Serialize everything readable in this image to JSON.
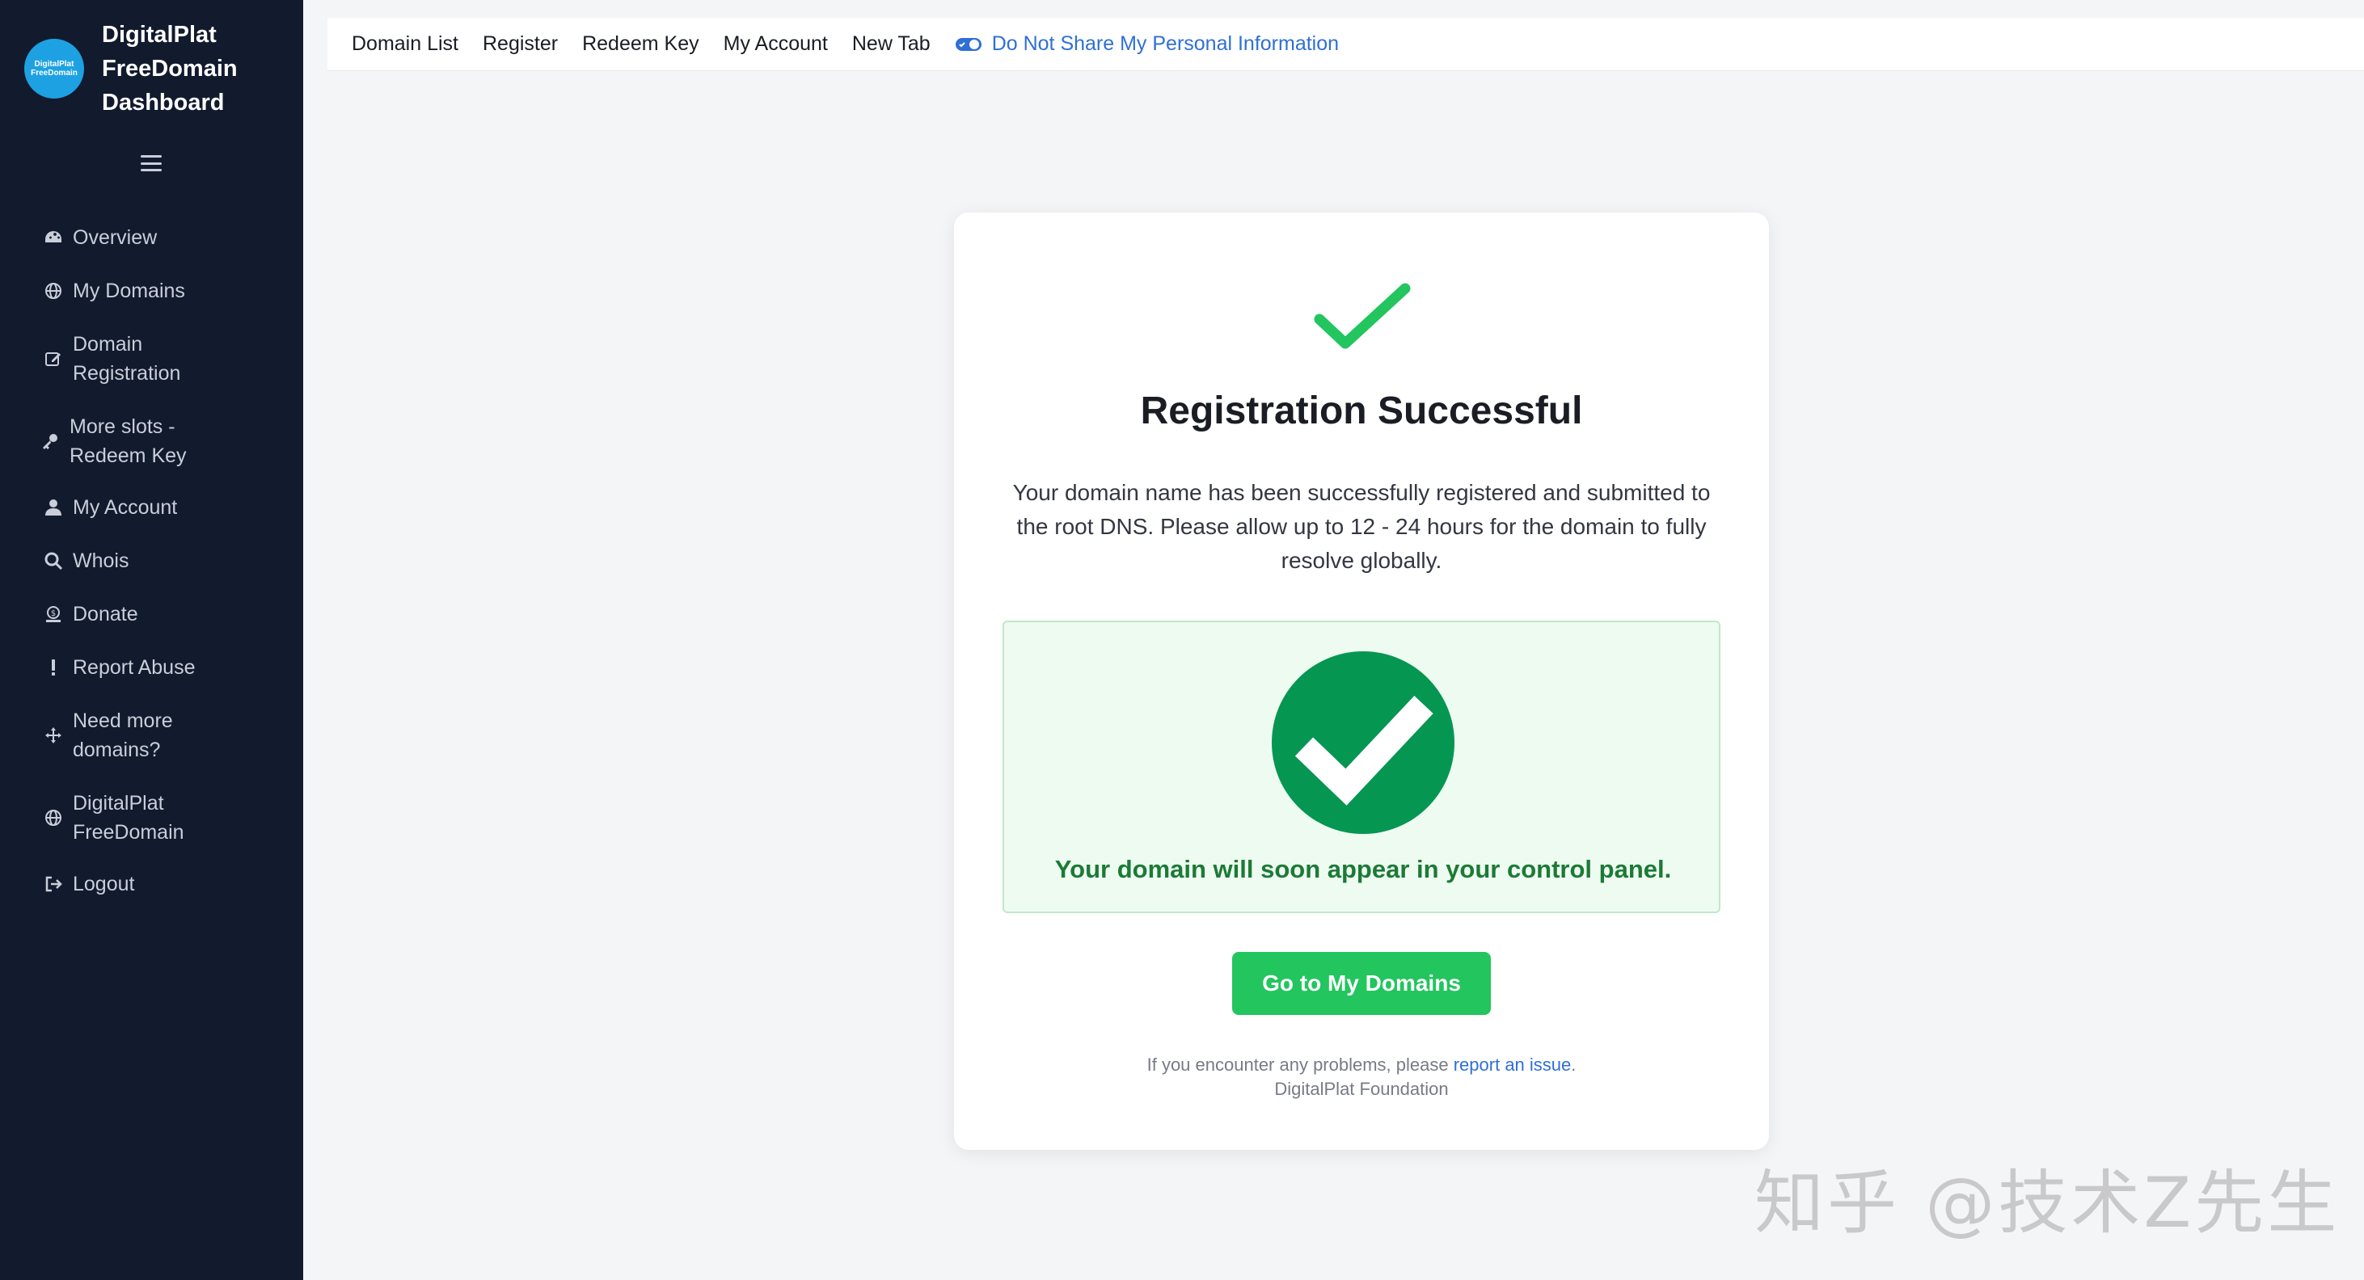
{
  "brand": {
    "logo_line1": "DigitalPlat",
    "logo_line2": "FreeDomain",
    "name_line1": "DigitalPlat",
    "name_line2": "FreeDomain",
    "name_line3": "Dashboard"
  },
  "sidebar": {
    "items": [
      {
        "label": "Overview",
        "icon": "dashboard-icon"
      },
      {
        "label": "My Domains",
        "icon": "globe-icon"
      },
      {
        "label": "Domain Registration",
        "icon": "edit-icon"
      },
      {
        "label": "More slots - Redeem Key",
        "icon": "key-icon"
      },
      {
        "label": "My Account",
        "icon": "user-icon"
      },
      {
        "label": "Whois",
        "icon": "search-icon"
      },
      {
        "label": "Donate",
        "icon": "donate-icon"
      },
      {
        "label": "Report Abuse",
        "icon": "exclamation-icon"
      },
      {
        "label": "Need more domains?",
        "icon": "arrows-icon"
      },
      {
        "label": "DigitalPlat FreeDomain",
        "icon": "globe-icon"
      },
      {
        "label": "Logout",
        "icon": "logout-icon"
      }
    ]
  },
  "topbar": {
    "links": [
      "Domain List",
      "Register",
      "Redeem Key",
      "My Account",
      "New Tab"
    ],
    "privacy": "Do Not Share My Personal Information"
  },
  "card": {
    "title": "Registration Successful",
    "description": "Your domain name has been successfully registered and submitted to the root DNS. Please allow up to 12 - 24 hours for the domain to fully resolve globally.",
    "success_message": "Your domain will soon appear in your control panel.",
    "button_label": "Go to My Domains",
    "footer_prefix": "If you encounter any problems, please ",
    "footer_link": "report an issue",
    "footer_suffix": ".",
    "footer_org": "DigitalPlat Foundation"
  },
  "watermark": "知乎 @技术Z先生",
  "colors": {
    "sidebar_bg": "#121a2e",
    "accent_green": "#22c55e",
    "dark_green": "#059652",
    "link_blue": "#2f6fd6"
  }
}
